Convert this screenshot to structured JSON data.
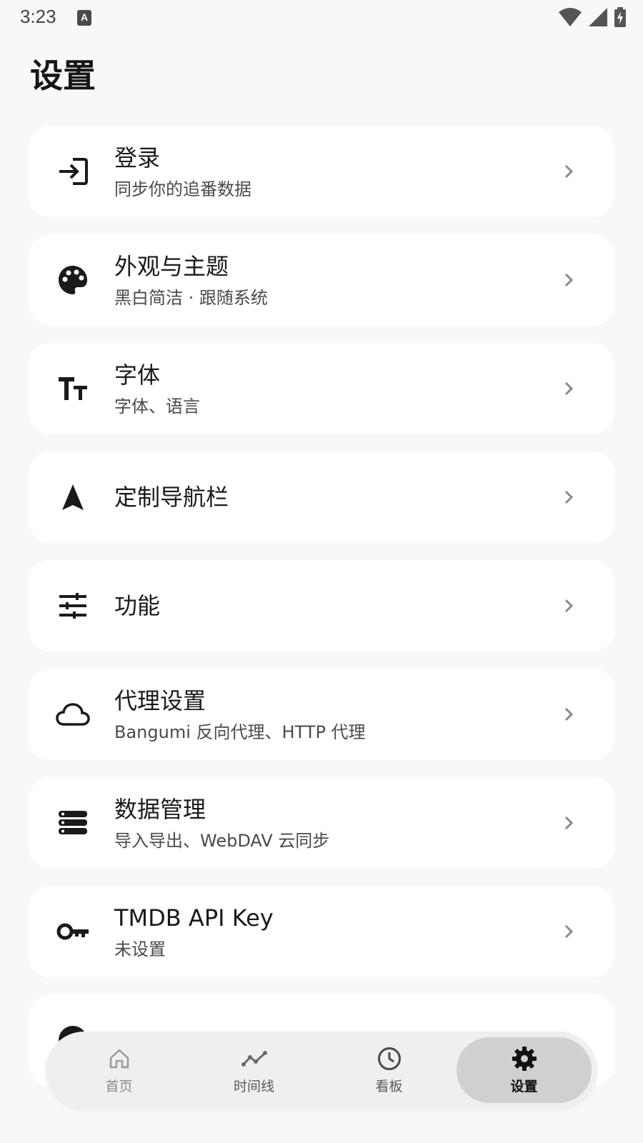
{
  "status_bar": {
    "time": "3:23",
    "notification_letter": "A"
  },
  "page": {
    "title": "设置"
  },
  "settings": [
    {
      "title": "登录",
      "subtitle": "同步你的追番数据",
      "icon": "login-icon"
    },
    {
      "title": "外观与主题",
      "subtitle": "黑白简洁 · 跟随系统",
      "icon": "palette-icon"
    },
    {
      "title": "字体",
      "subtitle": "字体、语言",
      "icon": "text-size-icon"
    },
    {
      "title": "定制导航栏",
      "subtitle": "",
      "icon": "navigation-arrow-icon"
    },
    {
      "title": "功能",
      "subtitle": "",
      "icon": "tune-icon"
    },
    {
      "title": "代理设置",
      "subtitle": "Bangumi 反向代理、HTTP 代理",
      "icon": "cloud-icon"
    },
    {
      "title": "数据管理",
      "subtitle": "导入导出、WebDAV 云同步",
      "icon": "storage-icon"
    },
    {
      "title": "TMDB API Key",
      "subtitle": "未设置",
      "icon": "key-icon"
    }
  ],
  "bottom_nav": [
    {
      "label": "首页",
      "icon": "home-icon",
      "active": false
    },
    {
      "label": "时间线",
      "icon": "timeline-icon",
      "active": false
    },
    {
      "label": "看板",
      "icon": "clock-icon",
      "active": false
    },
    {
      "label": "设置",
      "icon": "gear-icon",
      "active": true
    }
  ]
}
